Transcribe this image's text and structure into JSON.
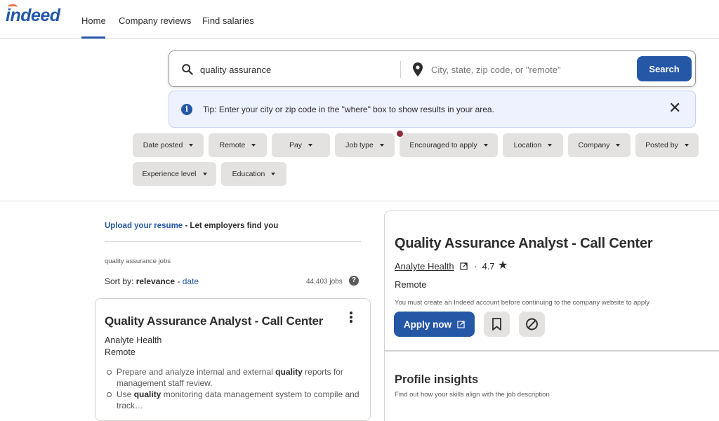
{
  "header": {
    "logo": "indeed",
    "nav": [
      "Home",
      "Company reviews",
      "Find salaries"
    ]
  },
  "search": {
    "what_value": "quality assurance",
    "where_placeholder": "City, state, zip code, or \"remote\"",
    "button_label": "Search"
  },
  "tip": {
    "text": "Tip: Enter your city or zip code in the \"where\" box to show results in your area."
  },
  "filters": [
    "Date posted",
    "Remote",
    "Pay",
    "Job type",
    "Encouraged to apply",
    "Location",
    "Company",
    "Posted by",
    "Experience level",
    "Education"
  ],
  "left": {
    "upload_link": "Upload your resume",
    "upload_rest": " - Let employers find you",
    "jobs_label": "quality assurance jobs",
    "sort_prefix": "Sort by: ",
    "sort_active": "relevance",
    "sort_sep": " - ",
    "sort_other": "date",
    "job_count": "44,403 jobs"
  },
  "card": {
    "title": "Quality Assurance Analyst - Call Center",
    "company": "Analyte Health",
    "location": "Remote",
    "bullets": [
      {
        "pre": "Prepare and analyze internal and external ",
        "bold": "quality",
        "post": " reports for management staff review."
      },
      {
        "pre": "Use ",
        "bold": "quality",
        "post": " monitoring data management system to compile and track…"
      }
    ]
  },
  "detail": {
    "title": "Quality Assurance Analyst - Call Center",
    "company": "Analyte Health",
    "rating_sep": "·",
    "rating": "4.7",
    "location": "Remote",
    "note": "You must create an Indeed account before continuing to the company website to apply",
    "apply_label": "Apply now",
    "insights_title": "Profile insights",
    "insights_sub": "Find out how your skills align with the job description"
  },
  "colors": {
    "brand": "#2557a7",
    "accent": "#ff6e42",
    "filter_bg": "#e4e2e0",
    "tip_bg": "#eef1fe"
  }
}
